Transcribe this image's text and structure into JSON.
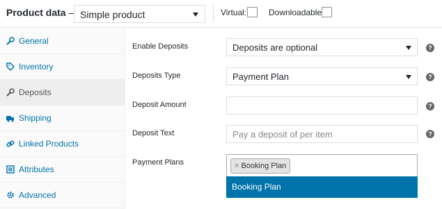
{
  "header": {
    "title": "Product data",
    "dash": "—",
    "product_type": "Simple product",
    "virtual_label": "Virtual:",
    "downloadable_label": "Downloadable:"
  },
  "sidebar": {
    "items": [
      {
        "label": "General",
        "icon": "wrench-icon"
      },
      {
        "label": "Inventory",
        "icon": "tag-icon"
      },
      {
        "label": "Deposits",
        "icon": "wrench-icon",
        "active": true
      },
      {
        "label": "Shipping",
        "icon": "truck-icon"
      },
      {
        "label": "Linked Products",
        "icon": "link-icon"
      },
      {
        "label": "Attributes",
        "icon": "list-icon"
      },
      {
        "label": "Advanced",
        "icon": "gear-icon"
      }
    ]
  },
  "form": {
    "enable_deposits": {
      "label": "Enable Deposits",
      "value": "Deposits are optional"
    },
    "deposits_type": {
      "label": "Deposits Type",
      "value": "Payment Plan"
    },
    "deposit_amount": {
      "label": "Deposit Amount",
      "value": ""
    },
    "deposit_text": {
      "label": "Deposit Text",
      "placeholder": "Pay a deposit of per item"
    },
    "payment_plans": {
      "label": "Payment Plans",
      "chip_remove": "×",
      "chip": "Booking Plan",
      "dropdown_option": "Booking Plan"
    },
    "help_glyph": "?"
  },
  "colors": {
    "link": "#0073aa",
    "highlight": "#0073aa",
    "active_tab_bg": "#eeeeee"
  }
}
